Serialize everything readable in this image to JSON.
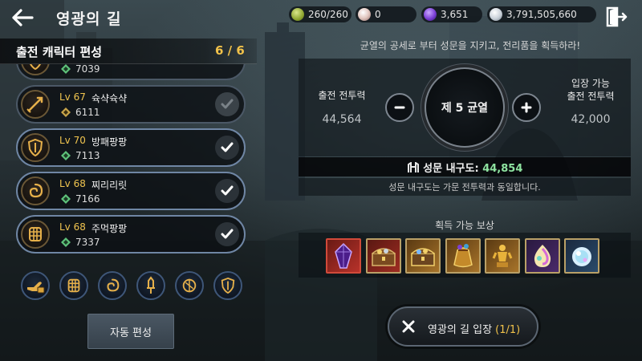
{
  "header": {
    "title": "영광의 길"
  },
  "resources": [
    {
      "name": "stamina",
      "value": "260/260",
      "icon": "leaf-coin-icon",
      "color": "#9fbf3a"
    },
    {
      "name": "pearl",
      "value": "0",
      "icon": "pearl-icon",
      "color": "#e6c9c3"
    },
    {
      "name": "gem",
      "value": "3,651",
      "icon": "purple-gem-icon",
      "color": "#7b3fd6"
    },
    {
      "name": "silver",
      "value": "3,791,505,660",
      "icon": "silver-coin-icon",
      "color": "#d9dde2"
    }
  ],
  "panel": {
    "title": "출전 캐릭터 편성",
    "count": "6 / 6"
  },
  "characters": [
    {
      "level": "",
      "name": "",
      "power": "7039",
      "checked": true,
      "emblem": "shield-emblem-icon"
    },
    {
      "level": "Lv 67",
      "name": "슉샥슉샥",
      "power": "6111",
      "checked": false,
      "emblem": "spear-emblem-icon"
    },
    {
      "level": "Lv 70",
      "name": "방패팡팡",
      "power": "7113",
      "checked": true,
      "emblem": "shield-emblem-icon"
    },
    {
      "level": "Lv 68",
      "name": "찌리리릿",
      "power": "7166",
      "checked": true,
      "emblem": "swirl-emblem-icon"
    },
    {
      "level": "Lv 68",
      "name": "주먹팡팡",
      "power": "7337",
      "checked": true,
      "emblem": "fist-emblem-icon"
    }
  ],
  "class_filters": [
    {
      "icon": "hand-class-icon"
    },
    {
      "icon": "fist-class-icon"
    },
    {
      "icon": "swirl-class-icon"
    },
    {
      "icon": "sword-class-icon"
    },
    {
      "icon": "orb-class-icon"
    },
    {
      "icon": "shield-class-icon"
    }
  ],
  "auto_button": "자동 편성",
  "mission_text": "균열의 공세로 부터 성문을 지키고, 전리품을 획득하라!",
  "stats": {
    "left_label": "출전 전투력",
    "left_value": "44,564",
    "right_label_1": "입장 가능",
    "right_label_2": "출전 전투력",
    "right_value": "42,000",
    "wave": "제 5 균열"
  },
  "gate": {
    "label": "성문 내구도: ",
    "value": "44,854",
    "sub": "성문 내구도는 가문 전투력과 동일합니다."
  },
  "rewards": {
    "title": "획득 가능 보상",
    "items": [
      {
        "icon": "purple-crystal-icon",
        "frame": "#c43a2a"
      },
      {
        "icon": "treasure-chest-icon",
        "frame": "#b9a067"
      },
      {
        "icon": "treasure-chest-gold-icon",
        "frame": "#b9a067"
      },
      {
        "icon": "pouch-icon",
        "frame": "#b9a067"
      },
      {
        "icon": "golden-trophy-icon",
        "frame": "#b9a067"
      },
      {
        "icon": "rainbow-orb-icon",
        "frame": "#b9a067"
      },
      {
        "icon": "crystal-orb-icon",
        "frame": "#b9a067"
      }
    ]
  },
  "enter_button": {
    "label": "영광의 길 입장 ",
    "count": "(1/1)"
  }
}
